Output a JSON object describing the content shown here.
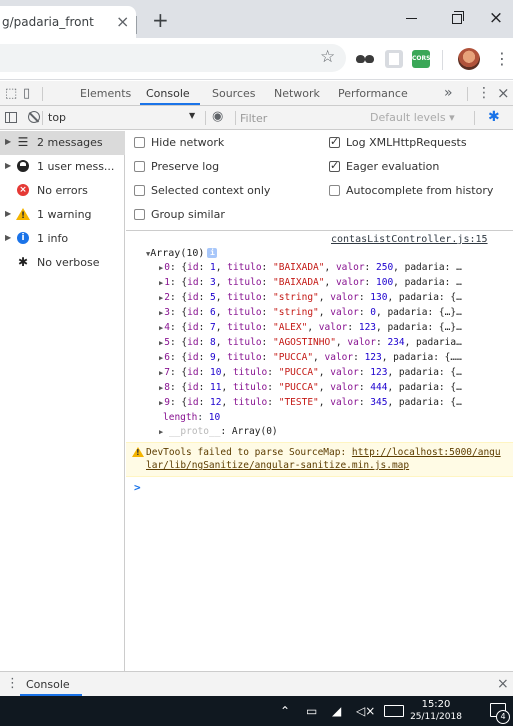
{
  "browser": {
    "tab_title": "g/padaria_front",
    "tab_close": "×",
    "new_tab": "+",
    "window": {
      "minimize": "",
      "maximize": "",
      "close": "×"
    },
    "extensions": {
      "cors_label": "CORS"
    },
    "icons": [
      "star-icon",
      "mustache-extension-icon",
      "pdf-extension-icon",
      "cors-extension-icon",
      "profile-avatar",
      "kebab-menu-icon"
    ]
  },
  "devtools": {
    "tabs": [
      {
        "label": "Elements"
      },
      {
        "label": "Console"
      },
      {
        "label": "Sources"
      },
      {
        "label": "Network"
      },
      {
        "label": "Performance"
      }
    ],
    "active_tab": "Console",
    "more": "»",
    "accent_color": "#1a73e8"
  },
  "console_toolbar": {
    "context": "top",
    "filter_placeholder": "Filter",
    "levels": "Default levels ▾"
  },
  "sidebar": {
    "items": [
      {
        "label": "2 messages",
        "icon": "list-icon",
        "glyph": "☰"
      },
      {
        "label": "1 user mess...",
        "icon": "user-icon"
      },
      {
        "label": "No errors",
        "icon": "error-icon",
        "glyph": "×"
      },
      {
        "label": "1 warning",
        "icon": "warning-icon"
      },
      {
        "label": "1 info",
        "icon": "info-icon",
        "glyph": "i"
      },
      {
        "label": "No verbose",
        "icon": "bug-icon",
        "glyph": "✱"
      }
    ]
  },
  "settings": {
    "hide_network": {
      "label": "Hide network",
      "checked": false
    },
    "preserve_log": {
      "label": "Preserve log",
      "checked": false
    },
    "selected_context": {
      "label": "Selected context only",
      "checked": false
    },
    "group_similar": {
      "label": "Group similar",
      "checked": false
    },
    "log_xhr": {
      "label": "Log XMLHttpRequests",
      "checked": true
    },
    "eager_eval": {
      "label": "Eager evaluation",
      "checked": true
    },
    "autocomplete": {
      "label": "Autocomplete from history",
      "checked": false
    }
  },
  "output": {
    "source": "contasListController.js:15",
    "array_label": "Array(10)",
    "info_badge": "i",
    "rows": [
      {
        "idx": "0",
        "id": "1",
        "titulo": "\"BAIXADA\"",
        "valor": "250",
        "rest": ", padaria: …"
      },
      {
        "idx": "1",
        "id": "3",
        "titulo": "\"BAIXADA\"",
        "valor": "100",
        "rest": ", padaria: …"
      },
      {
        "idx": "2",
        "id": "5",
        "titulo": "\"string\"",
        "valor": "130",
        "rest": ", padaria: {…"
      },
      {
        "idx": "3",
        "id": "6",
        "titulo": "\"string\"",
        "valor": "0",
        "rest": ", padaria: {…}…"
      },
      {
        "idx": "4",
        "id": "7",
        "titulo": "\"ALEX\"",
        "valor": "123",
        "rest": ", padaria: {…}…"
      },
      {
        "idx": "5",
        "id": "8",
        "titulo": "\"AGOSTINHO\"",
        "valor": "234",
        "rest": ", padaria…"
      },
      {
        "idx": "6",
        "id": "9",
        "titulo": "\"PUCCA\"",
        "valor": "123",
        "rest": ", padaria: {……"
      },
      {
        "idx": "7",
        "id": "10",
        "titulo": "\"PUCCA\"",
        "valor": "123",
        "rest": ", padaria: {…"
      },
      {
        "idx": "8",
        "id": "11",
        "titulo": "\"PUCCA\"",
        "valor": "444",
        "rest": ", padaria: {…"
      },
      {
        "idx": "9",
        "id": "12",
        "titulo": "\"TESTE\"",
        "valor": "345",
        "rest": ", padaria: {…"
      }
    ],
    "length_key": "length",
    "length_value": "10",
    "proto_key": "__proto__",
    "proto_value": "Array(0)",
    "warning_prefix": "DevTools failed to parse SourceMap: ",
    "warning_link": "http://localhost:5000/angular/lib/ngSanitize/angular-sanitize.min.js.map",
    "prompt": ">"
  },
  "drawer": {
    "tab": "Console",
    "close": "×"
  },
  "taskbar": {
    "time": "15:20",
    "date": "25/11/2018",
    "notifications": "4"
  }
}
